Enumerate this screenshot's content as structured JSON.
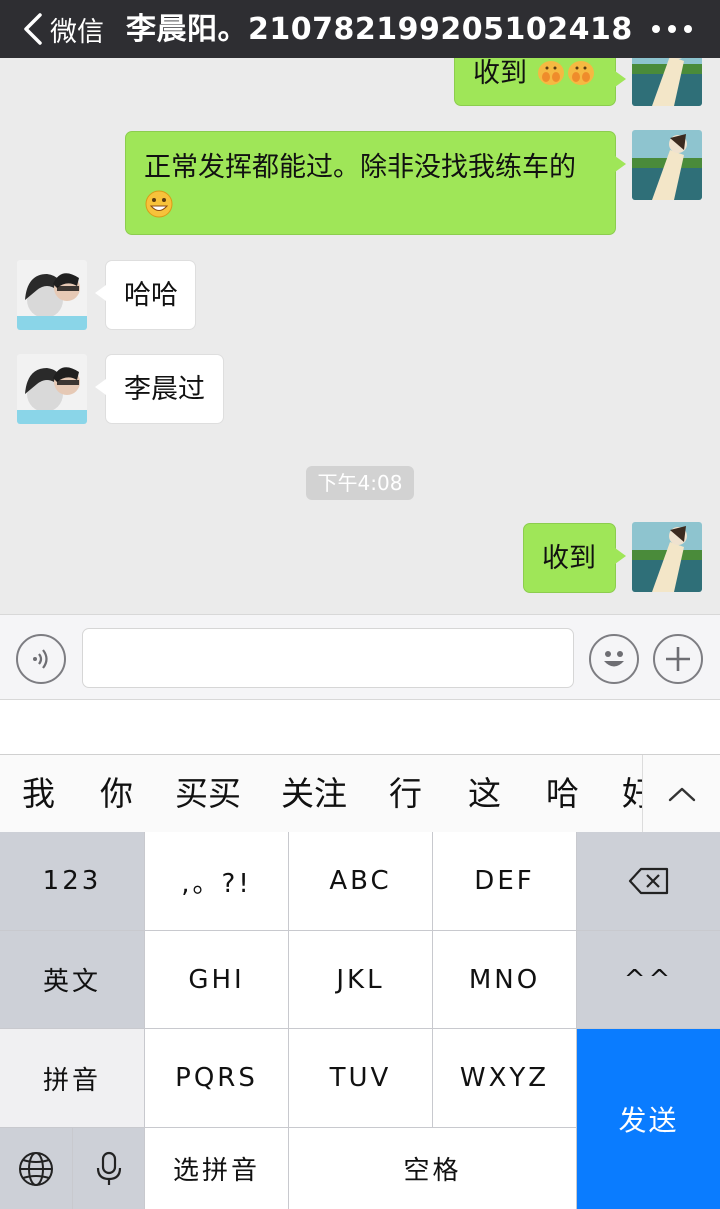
{
  "navbar": {
    "back_label": "微信",
    "title": "李晨阳。210782199205102418",
    "more_icon": "more-dots-icon"
  },
  "messages": [
    {
      "side": "out",
      "text": "收到",
      "emojis": [
        "hands-emoji",
        "hands-emoji"
      ]
    },
    {
      "side": "out",
      "text": "正常发挥都能过。除非没找我练车的",
      "emojis": [
        "grin-emoji"
      ]
    },
    {
      "side": "in",
      "text": "哈哈"
    },
    {
      "side": "in",
      "text": "李晨过"
    },
    {
      "side": "out",
      "text": "收到"
    }
  ],
  "timestamp": "下午4:08",
  "input_bar": {
    "voice_icon": "voice-icon",
    "message_value": "",
    "emoji_icon": "emoji-icon",
    "plus_icon": "plus-icon"
  },
  "candidates": [
    "我",
    "你",
    "买买",
    "关注",
    "行",
    "这",
    "哈",
    "好"
  ],
  "keyboard": {
    "keys_row1": [
      "123",
      ",。?!",
      "ABC",
      "DEF"
    ],
    "keys_row2": [
      "英文",
      "GHI",
      "JKL",
      "MNO",
      "^^"
    ],
    "keys_row3": [
      "拼音",
      "PQRS",
      "TUV",
      "WXYZ"
    ],
    "keys_row4": [
      "选拼音",
      "空格"
    ],
    "send_label": "发送"
  },
  "colors": {
    "navbar": "#2e2e32",
    "bubble_out": "#9fe658",
    "bubble_in": "#ffffff",
    "send_key": "#0a7cff",
    "chat_bg": "#ebebeb"
  }
}
